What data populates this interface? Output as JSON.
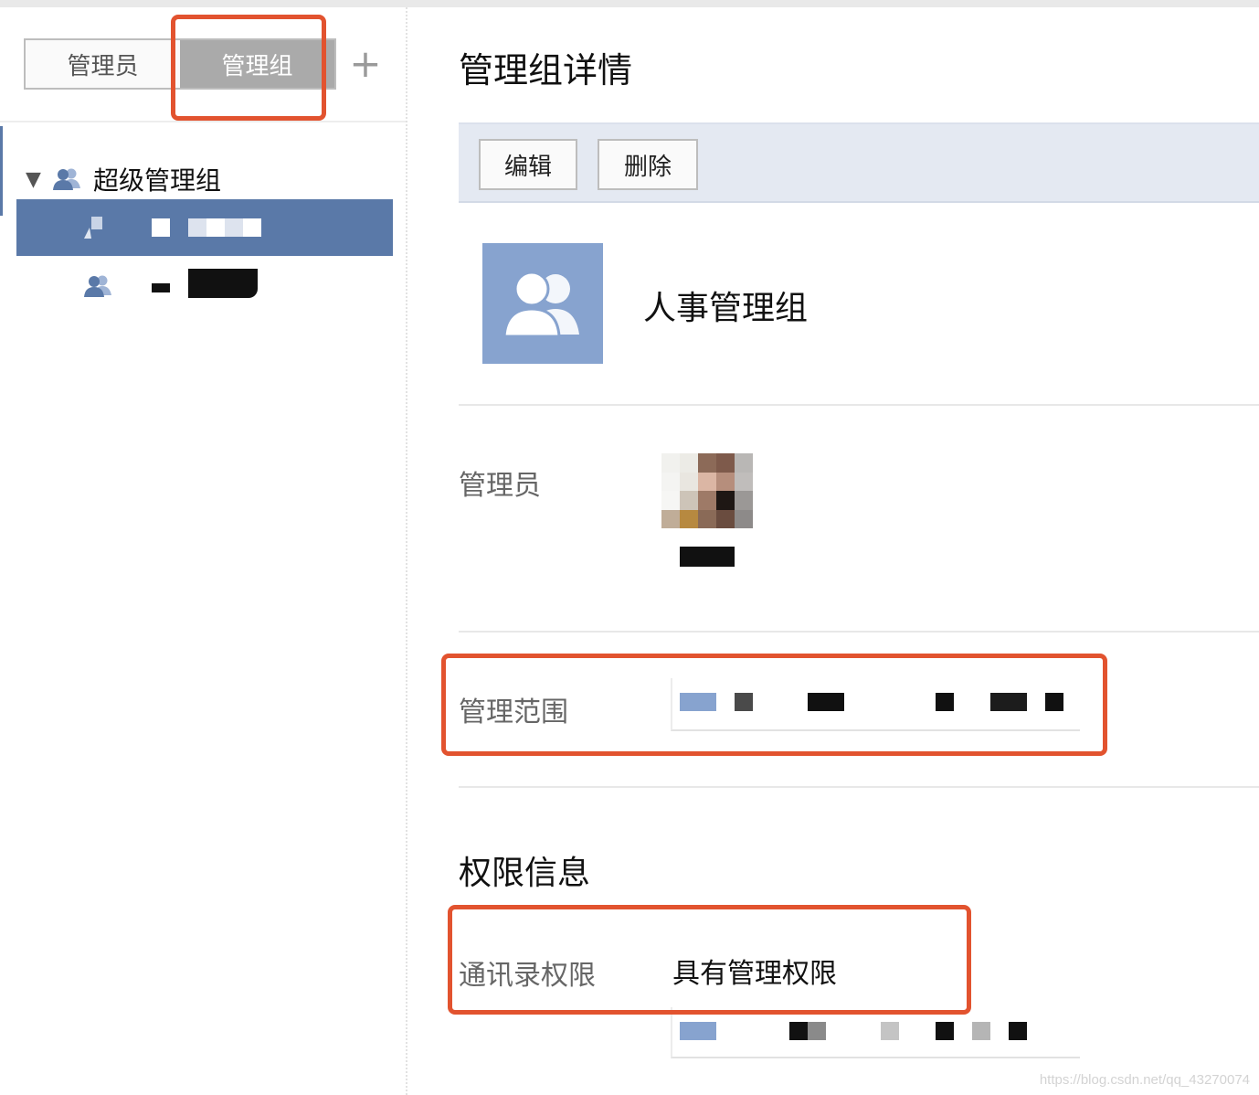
{
  "sidebar": {
    "tabs": [
      {
        "label": "管理员",
        "active": false
      },
      {
        "label": "管理组",
        "active": true
      }
    ],
    "add_label": "+",
    "tree": {
      "root_label": "超级管理组",
      "children_masked": 2,
      "selected_index": 0
    }
  },
  "detail": {
    "title": "管理组详情",
    "toolbar": {
      "edit_label": "编辑",
      "delete_label": "删除"
    },
    "group_name": "人事管理组",
    "admin_label": "管理员",
    "scope_label": "管理范围",
    "permissions_title": "权限信息",
    "contacts_perm_label": "通讯录权限",
    "contacts_perm_value": "具有管理权限"
  },
  "watermark": "https://blog.csdn.net/qq_43270074",
  "colors": {
    "accent": "#5a79a8",
    "avatar_bg": "#87a3cf",
    "toolbar_bg": "#e4e9f2",
    "highlight": "#e2532f",
    "active_tab": "#aaaaaa"
  }
}
